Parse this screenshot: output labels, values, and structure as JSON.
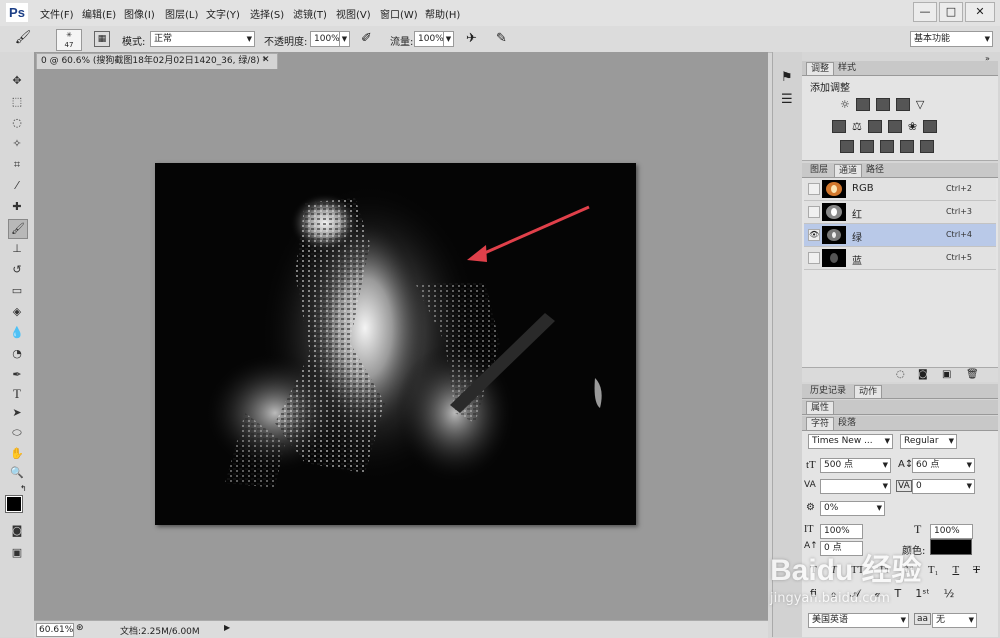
{
  "app": {
    "logo": "Ps"
  },
  "menu": [
    "文件(F)",
    "编辑(E)",
    "图像(I)",
    "图层(L)",
    "文字(Y)",
    "选择(S)",
    "滤镜(T)",
    "视图(V)",
    "窗口(W)",
    "帮助(H)"
  ],
  "window_controls": {
    "minimize": "—",
    "restore": "□",
    "close": "✕"
  },
  "options": {
    "brush_size": "47",
    "mode_label": "模式:",
    "mode_value": "正常",
    "opacity_label": "不透明度:",
    "opacity_value": "100%",
    "flow_label": "流量:",
    "flow_value": "100%",
    "workspace": "基本功能"
  },
  "document": {
    "tab_title": "0 @ 60.6% (搜狗截图18年02月02日1420_36, 绿/8) *",
    "zoom": "60.61%",
    "doc_info": "文档:2.25M/6.00M"
  },
  "adjust_panel": {
    "tabs": [
      "调整",
      "样式"
    ],
    "title": "添加调整"
  },
  "channels_panel": {
    "tabs": [
      "图层",
      "通道",
      "路径"
    ],
    "channels": [
      {
        "name": "RGB",
        "shortcut": "Ctrl+2",
        "visible": false,
        "selected": false
      },
      {
        "name": "红",
        "shortcut": "Ctrl+3",
        "visible": false,
        "selected": false
      },
      {
        "name": "绿",
        "shortcut": "Ctrl+4",
        "visible": true,
        "selected": true
      },
      {
        "name": "蓝",
        "shortcut": "Ctrl+5",
        "visible": false,
        "selected": false
      }
    ],
    "eye_glyph": "👁"
  },
  "history_panel": {
    "tabs": [
      "历史记录",
      "动作"
    ]
  },
  "properties_panel": {
    "tab": "属性"
  },
  "character_panel": {
    "tabs": [
      "字符",
      "段落"
    ],
    "font_family": "Times New ...",
    "font_style": "Regular",
    "font_size": "500 点",
    "leading": "60 点",
    "kerning": "",
    "tracking": "0",
    "scale_percent": "0%",
    "vertical_scale": "100%",
    "horizontal_scale": "100%",
    "baseline_shift": "0 点",
    "color_label": "颜色:",
    "language": "美国英语",
    "antialias": "无"
  },
  "watermark": {
    "text": "Baidu 经验",
    "url": "jingyan.baidu.com"
  },
  "colors": {
    "accent_arrow": "#e0404a",
    "selection_blue": "#b9c9e8"
  }
}
